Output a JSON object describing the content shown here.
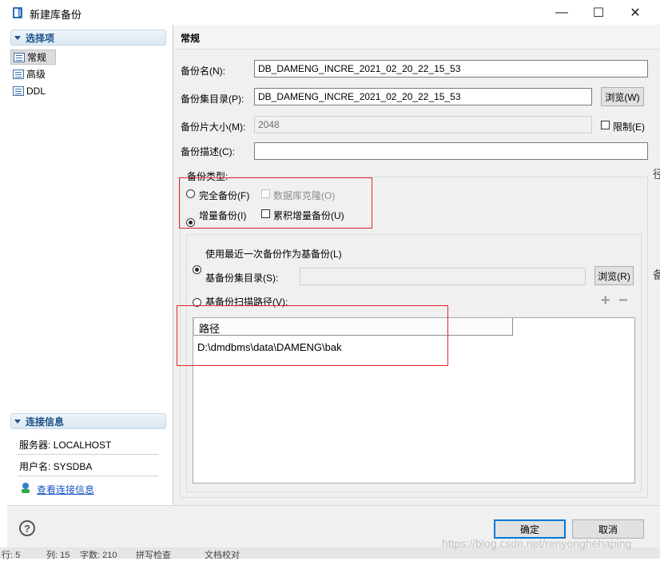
{
  "window": {
    "title": "新建库备份",
    "minimize": "—",
    "maximize": "☐",
    "close": "✕"
  },
  "sidebar": {
    "section_label": "选择项",
    "items": [
      {
        "label": "常规",
        "selected": true
      },
      {
        "label": "高级",
        "selected": false
      },
      {
        "label": "DDL",
        "selected": false
      }
    ],
    "connection": {
      "section_label": "连接信息",
      "server": "服务器: LOCALHOST",
      "user": "用户名: SYSDBA",
      "view_link": "查看连接信息"
    }
  },
  "main": {
    "header": "常规",
    "backup_name_label": "备份名(N):",
    "backup_name_value": "DB_DAMENG_INCRE_2021_02_20_22_15_53",
    "backup_dir_label": "备份集目录(P):",
    "backup_dir_value": "DB_DAMENG_INCRE_2021_02_20_22_15_53",
    "browse_label": "浏览(W)",
    "piece_size_label": "备份片大小(M):",
    "piece_size_value": "2048",
    "limit_label": "限制(E)",
    "limit_checked": false,
    "desc_label": "备份描述(C):",
    "desc_value": "",
    "type_group_label": "备份类型:",
    "full_backup_label": "完全备份(F)",
    "full_backup_checked": false,
    "db_clone_label": "数据库克隆(O)",
    "incremental_label": "增量备份(I)",
    "incremental_checked": true,
    "cumulative_label": "累积增量备份(U)",
    "cumulative_checked": false,
    "use_latest_label": "使用最近一次备份作为基备份(L)",
    "use_latest_checked": true,
    "base_dir_label": "基备份集目录(S):",
    "base_dir_value": "",
    "base_browse_label": "浏览(R)",
    "scan_path_label": "基备份扫描路径(V):",
    "add_icon": "+",
    "remove_icon": "−",
    "table": {
      "columns": [
        "路径"
      ],
      "rows": [
        [
          "D:\\dmdbms\\data\\DAMENG\\bak"
        ]
      ]
    }
  },
  "footer": {
    "help": "?",
    "ok_label": "确定",
    "cancel_label": "取消"
  },
  "statusbar": {
    "row": "行: 5",
    "col": "列: 15",
    "chars": "字数: 210",
    "spell": "拼写检查",
    "proof": "文档校对"
  },
  "watermark": "https://blog.csdn.net/renyonghehaping",
  "edge_chars": [
    "径",
    "备"
  ],
  "colors": {
    "accent": "#0078d7",
    "section_header_text": "#1c4f86",
    "highlight_box": "#e0272a"
  }
}
